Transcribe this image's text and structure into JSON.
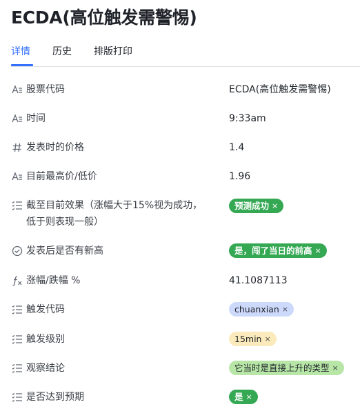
{
  "title": "ECDA(高位触发需警惕)",
  "tabs": [
    {
      "label": "详情",
      "active": true
    },
    {
      "label": "历史",
      "active": false
    },
    {
      "label": "排版打印",
      "active": false
    }
  ],
  "fields": [
    {
      "icon": "text-field-icon",
      "label": "股票代码",
      "value": "ECDA(高位触发需警惕)"
    },
    {
      "icon": "text-field-icon",
      "label": "时间",
      "value": "9:33am"
    },
    {
      "icon": "hash-icon",
      "label": "发表时的价格",
      "value": "1.4"
    },
    {
      "icon": "text-field-icon",
      "label": "目前最高价/低价",
      "value": "1.96"
    },
    {
      "icon": "list-icon",
      "label_line1": "截至目前效果（涨幅大于15%视为成功，",
      "label_line2": "低于则表现一般）",
      "tag": "预测成功",
      "tag_style": "green"
    },
    {
      "icon": "check-circle-icon",
      "label": "发表后是否有新高",
      "tag": "是，闯了当日的前高",
      "tag_style": "green"
    },
    {
      "icon": "formula-icon",
      "label": "涨幅/跌幅 %",
      "value": "41.1087113"
    },
    {
      "icon": "list-icon",
      "label": "触发代码",
      "tag": "chuanxian",
      "tag_style": "blue"
    },
    {
      "icon": "list-icon",
      "label": "触发级别",
      "tag": "15min",
      "tag_style": "yellow"
    },
    {
      "icon": "list-icon",
      "label": "观察结论",
      "tag": "它当时是直接上升的类型",
      "tag_style": "lightgreen"
    },
    {
      "icon": "list-icon",
      "label": "是否达到预期",
      "tag": "是",
      "tag_style": "green"
    }
  ],
  "tag_close_glyph": "×",
  "colors": {
    "accent": "#3370ff",
    "tag_green": "#34a853",
    "tag_blue": "#cdd9fb",
    "tag_yellow": "#fbeabb",
    "tag_lightgreen": "#b7e6a7",
    "divider": "#dee0e3"
  }
}
